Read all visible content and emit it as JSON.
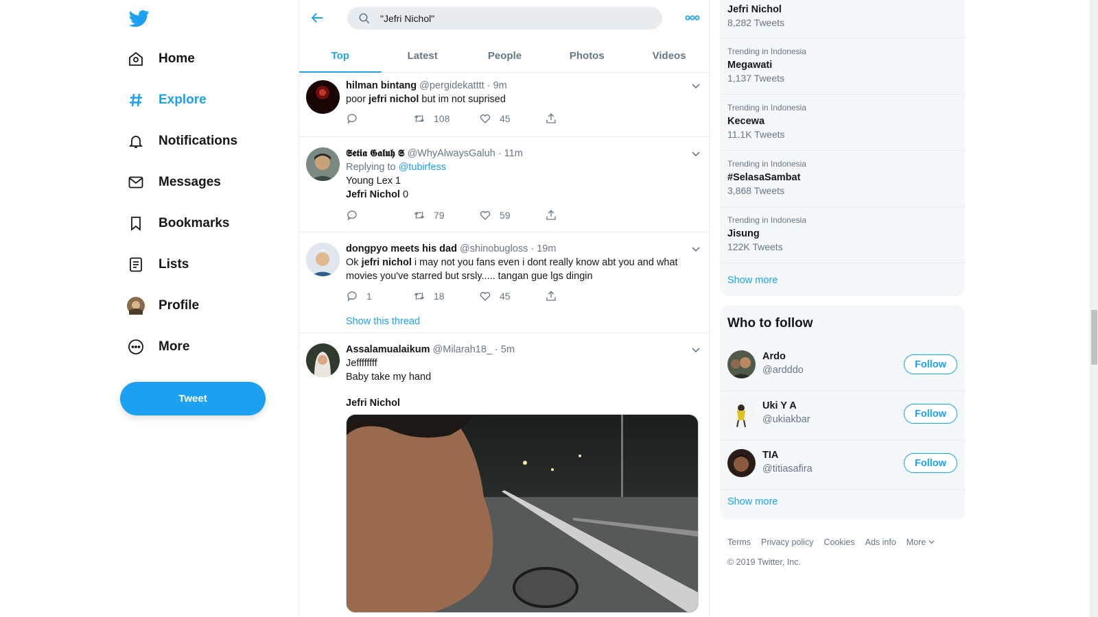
{
  "colors": {
    "accent": "#1da1f2",
    "text": "#14171a",
    "muted": "#657786",
    "border": "#e6ecf0",
    "panel": "#f5f8fa"
  },
  "nav": {
    "logo_icon": "twitter-bird-icon",
    "items": [
      {
        "label": "Home",
        "icon": "home-icon"
      },
      {
        "label": "Explore",
        "icon": "hash-icon"
      },
      {
        "label": "Notifications",
        "icon": "bell-icon"
      },
      {
        "label": "Messages",
        "icon": "mail-icon"
      },
      {
        "label": "Bookmarks",
        "icon": "bookmark-icon"
      },
      {
        "label": "Lists",
        "icon": "list-icon"
      },
      {
        "label": "Profile",
        "icon": "avatar"
      },
      {
        "label": "More",
        "icon": "more-circle-icon"
      }
    ],
    "tweet_button": "Tweet"
  },
  "search": {
    "query": "\"Jefri Nichol\""
  },
  "tabs": [
    "Top",
    "Latest",
    "People",
    "Photos",
    "Videos"
  ],
  "tweets": [
    {
      "name": "hilman bintang",
      "handle": "@pergidekatttt",
      "time": "9m",
      "text_pre": "poor ",
      "text_bold": "jefri nichol",
      "text_post": " but im not suprised",
      "reply_count": "",
      "retweet_count": "108",
      "like_count": "45"
    },
    {
      "name": "𝕾𝖊𝖙𝖎𝖆 𝕲𝖆𝖑𝖚𝖍 𝕾",
      "handle": "@WhyAlwaysGaluh",
      "time": "11m",
      "replying_label": "Replying to ",
      "replying_to": "@tubirfess",
      "line1": "Young Lex 1",
      "line2_bold": "Jefri Nichol",
      "line2_post": " 0",
      "reply_count": "",
      "retweet_count": "79",
      "like_count": "59"
    },
    {
      "name": "dongpyo meets his dad",
      "handle": "@shinobugloss",
      "time": "19m",
      "text_pre": "Ok ",
      "text_bold": "jefri nichol",
      "text_post": " i may not you fans even i dont really know abt you and what movies you've starred but srsly..... tangan gue lgs dingin",
      "reply_count": "1",
      "retweet_count": "18",
      "like_count": "45",
      "show_thread": "Show this thread"
    },
    {
      "name": "Assalamualaikum",
      "handle": "@Milarah18_",
      "time": "5m",
      "line1": "Jeffffffff",
      "line2": "Baby take my hand",
      "line3_bold": "Jefri Nichol"
    }
  ],
  "trends": [
    {
      "context": "",
      "name": "Jefri Nichol",
      "count": "8,282 Tweets"
    },
    {
      "context": "Trending in Indonesia",
      "name": "Megawati",
      "count": "1,137 Tweets"
    },
    {
      "context": "Trending in Indonesia",
      "name": "Kecewa",
      "count": "11.1K Tweets"
    },
    {
      "context": "Trending in Indonesia",
      "name": "#SelasaSambat",
      "count": "3,868 Tweets"
    },
    {
      "context": "Trending in Indonesia",
      "name": "Jisung",
      "count": "122K Tweets"
    }
  ],
  "trends_show_more": "Show more",
  "who_to_follow": {
    "title": "Who to follow",
    "users": [
      {
        "name": "Ardo",
        "handle": "@ardddo",
        "button": "Follow"
      },
      {
        "name": "Uki Y A",
        "handle": "@ukiakbar",
        "button": "Follow"
      },
      {
        "name": "TIA",
        "handle": "@titiasafira",
        "button": "Follow"
      }
    ],
    "show_more": "Show more"
  },
  "footer": {
    "links": [
      "Terms",
      "Privacy policy",
      "Cookies",
      "Ads info",
      "More"
    ],
    "copyright": "© 2019 Twitter, Inc."
  }
}
